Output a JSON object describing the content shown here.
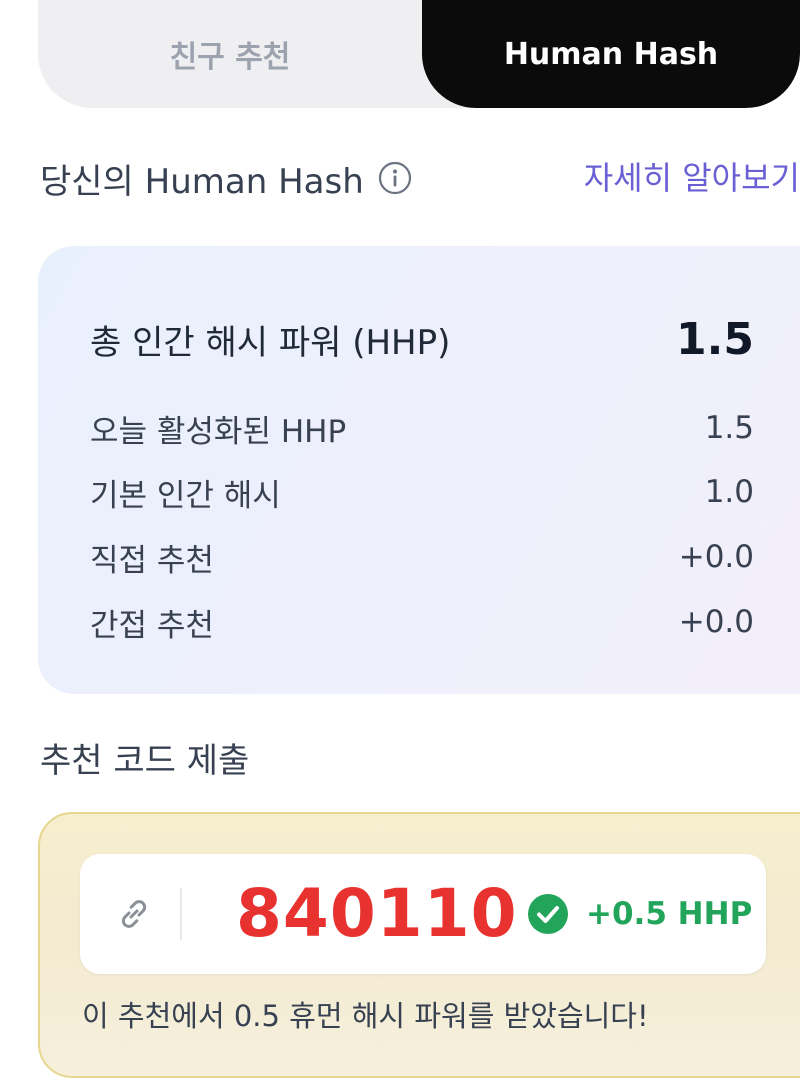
{
  "tabs": {
    "friends_label": "친구 추천",
    "hash_label": "Human Hash",
    "active": "Human Hash"
  },
  "header": {
    "title": "당신의 Human Hash",
    "learn_more": "자세히 알아보기",
    "info_icon": "info-circle-icon"
  },
  "stats": {
    "total": {
      "label": "총 인간 해시 파워 (HHP)",
      "value": "1.5"
    },
    "rows": [
      {
        "label": "오늘 활성화된 HHP",
        "value": "1.5"
      },
      {
        "label": "기본 인간 해시",
        "value": "1.0"
      },
      {
        "label": "직접 추천",
        "value": "+0.0"
      },
      {
        "label": "간접 추천",
        "value": "+0.0"
      }
    ]
  },
  "submit": {
    "title": "추천 코드 제출",
    "link_icon": "link-icon",
    "code": "840110",
    "status_icon": "check-circle-icon",
    "bonus": "+0.5 HHP",
    "message": "이 추천에서 0.5 휴먼 해시 파워를 받았습니다!"
  },
  "colors": {
    "accent_purple": "#6b5fd4",
    "code_red": "#e8322f",
    "success_green": "#22a55a",
    "active_tab_bg": "#0b0b0b"
  }
}
